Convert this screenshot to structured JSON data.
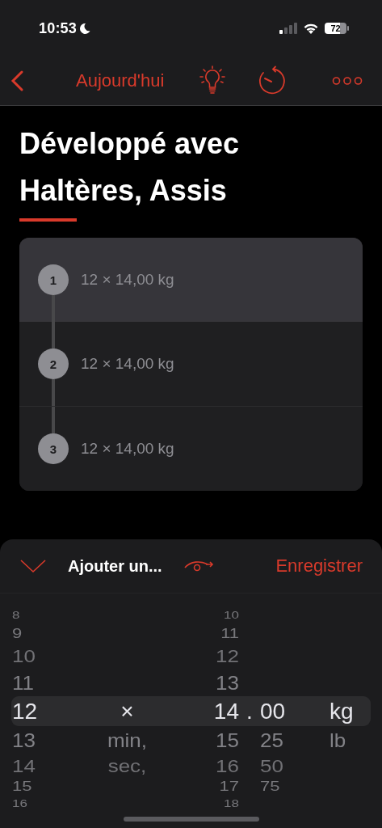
{
  "status_bar": {
    "time": "10:53",
    "battery": "72"
  },
  "nav_bar": {
    "back_label": "Aujourd'hui"
  },
  "exercise": {
    "title": "Développé avec Haltères, Assis"
  },
  "sets": [
    {
      "number": "1",
      "text": "12 × 14,00 kg",
      "selected": true
    },
    {
      "number": "2",
      "text": "12 × 14,00 kg",
      "selected": false
    },
    {
      "number": "3",
      "text": "12 × 14,00 kg",
      "selected": false
    }
  ],
  "input_sheet": {
    "title": "Ajouter un...",
    "save_label": "Enregistrer",
    "picker": [
      {
        "kind": "reps",
        "items": [
          {
            "text": "8",
            "selected": false
          },
          {
            "text": "9",
            "selected": false
          },
          {
            "text": "10",
            "selected": false
          },
          {
            "text": "11",
            "selected": false
          },
          {
            "text": "12",
            "selected": true
          },
          {
            "text": "13",
            "selected": false
          },
          {
            "text": "14",
            "selected": false
          },
          {
            "text": "15",
            "selected": false
          },
          {
            "text": "16",
            "selected": false
          }
        ]
      },
      {
        "kind": "mode",
        "items": [
          {
            "text": "×",
            "selected": true
          },
          {
            "text": "min,",
            "selected": false
          },
          {
            "text": "sec,",
            "selected": false
          }
        ]
      },
      {
        "kind": "weight",
        "items": [
          {
            "text": "10",
            "selected": false
          },
          {
            "text": "11",
            "selected": false
          },
          {
            "text": "12",
            "selected": false
          },
          {
            "text": "13",
            "selected": false
          },
          {
            "text": "14",
            "selected": true
          },
          {
            "text": "15",
            "selected": false
          },
          {
            "text": "16",
            "selected": false
          },
          {
            "text": "17",
            "selected": false
          },
          {
            "text": "18",
            "selected": false
          }
        ]
      },
      {
        "kind": "separator",
        "items": [
          {
            "text": ".",
            "selected": true
          }
        ]
      },
      {
        "kind": "fraction",
        "items": [
          {
            "text": "00",
            "selected": true
          },
          {
            "text": "25",
            "selected": false
          },
          {
            "text": "50",
            "selected": false
          },
          {
            "text": "75",
            "selected": false
          }
        ]
      },
      {
        "kind": "unit",
        "items": [
          {
            "text": "kg",
            "selected": true
          },
          {
            "text": "lb",
            "selected": false
          }
        ]
      }
    ]
  }
}
